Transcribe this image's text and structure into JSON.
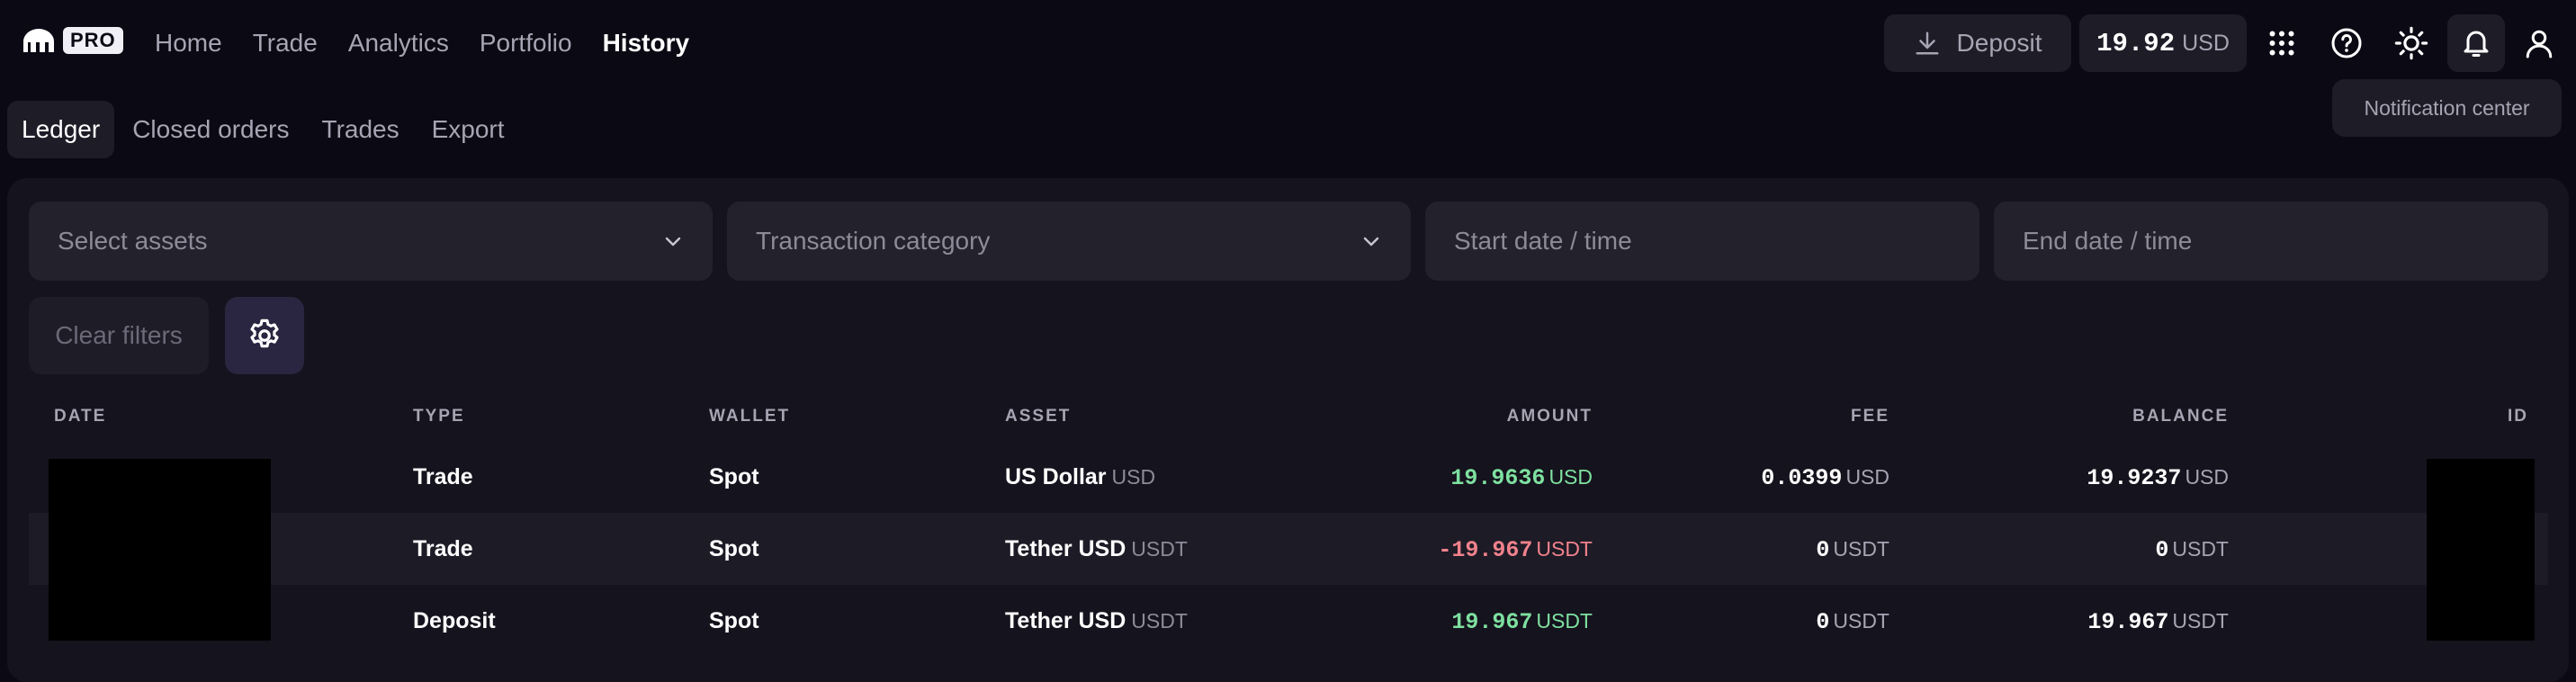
{
  "logo": {
    "text": "PRO"
  },
  "nav": {
    "items": [
      {
        "label": "Home"
      },
      {
        "label": "Trade"
      },
      {
        "label": "Analytics"
      },
      {
        "label": "Portfolio"
      },
      {
        "label": "History",
        "active": true
      }
    ]
  },
  "header": {
    "deposit_label": "Deposit",
    "balance_value": "19.92",
    "balance_currency": "USD",
    "icons": [
      "apps-grid-icon",
      "help-icon",
      "theme-sun-icon",
      "bell-icon",
      "user-icon"
    ],
    "tooltip": "Notification center"
  },
  "tabs": [
    {
      "label": "Ledger",
      "active": true
    },
    {
      "label": "Closed orders"
    },
    {
      "label": "Trades"
    },
    {
      "label": "Export"
    }
  ],
  "filters": {
    "assets_placeholder": "Select assets",
    "category_placeholder": "Transaction category",
    "start_placeholder": "Start date / time",
    "end_placeholder": "End date / time",
    "clear_label": "Clear filters"
  },
  "table": {
    "headers": {
      "date": "DATE",
      "type": "TYPE",
      "wallet": "WALLET",
      "asset": "ASSET",
      "amount": "AMOUNT",
      "fee": "FEE",
      "balance": "BALANCE",
      "id": "ID"
    },
    "rows": [
      {
        "type": "Trade",
        "wallet": "Spot",
        "asset_name": "US Dollar",
        "asset_code": "USD",
        "amount": "19.9636",
        "amount_cur": "USD",
        "fee": "0.0399",
        "fee_cur": "USD",
        "balance": "19.9237",
        "balance_cur": "USD"
      },
      {
        "type": "Trade",
        "wallet": "Spot",
        "asset_name": "Tether USD",
        "asset_code": "USDT",
        "amount": "-19.967",
        "amount_cur": "USDT",
        "fee": "0",
        "fee_cur": "USDT",
        "balance": "0",
        "balance_cur": "USDT"
      },
      {
        "type": "Deposit",
        "wallet": "Spot",
        "asset_name": "Tether USD",
        "asset_code": "USDT",
        "amount": "19.967",
        "amount_cur": "USDT",
        "fee": "0",
        "fee_cur": "USDT",
        "balance": "19.967",
        "balance_cur": "USDT"
      }
    ]
  },
  "colors": {
    "background": "#0b0913",
    "panel": "#15131d",
    "positive": "#7ee0a0",
    "negative": "#f0828c"
  }
}
